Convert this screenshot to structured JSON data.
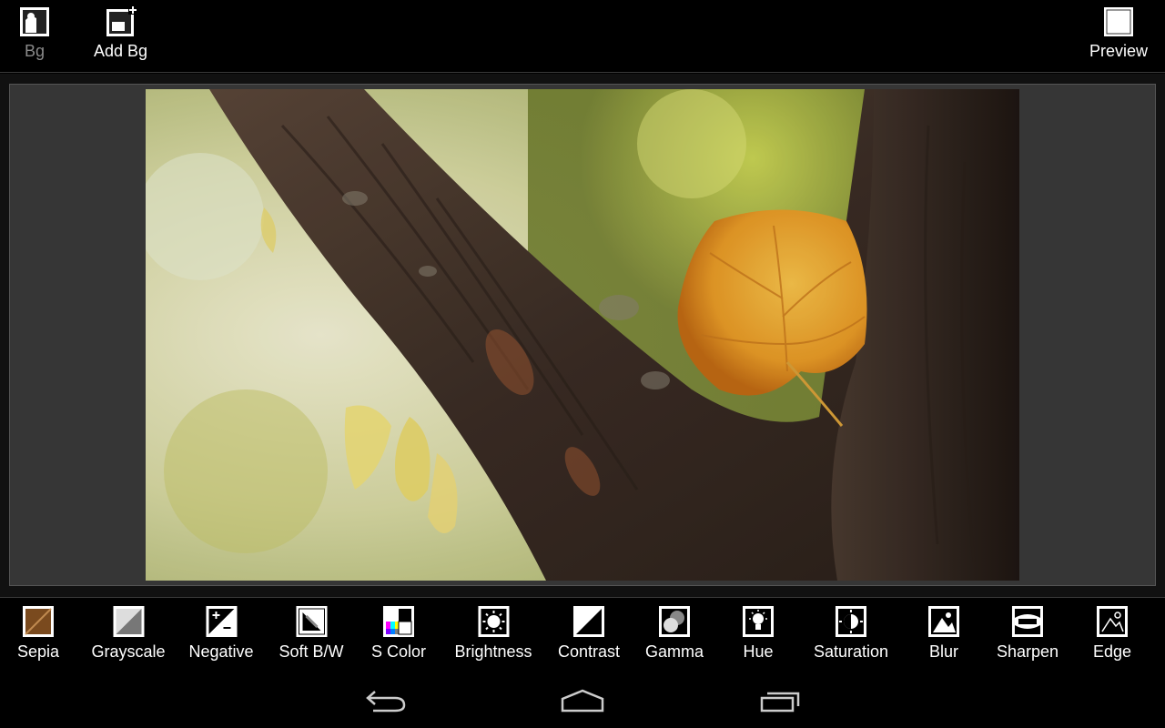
{
  "toolbar": {
    "bg_label": "Bg",
    "add_bg_label": "Add Bg",
    "preview_label": "Preview"
  },
  "effects": [
    {
      "label": "Sepia",
      "icon": "sepia-icon"
    },
    {
      "label": "Grayscale",
      "icon": "grayscale-icon"
    },
    {
      "label": "Negative",
      "icon": "negative-icon"
    },
    {
      "label": "Soft B/W",
      "icon": "soft-bw-icon"
    },
    {
      "label": "S Color",
      "icon": "s-color-icon"
    },
    {
      "label": "Brightness",
      "icon": "brightness-icon"
    },
    {
      "label": "Contrast",
      "icon": "contrast-icon"
    },
    {
      "label": "Gamma",
      "icon": "gamma-icon"
    },
    {
      "label": "Hue",
      "icon": "hue-icon"
    },
    {
      "label": "Saturation",
      "icon": "saturation-icon"
    },
    {
      "label": "Blur",
      "icon": "blur-icon"
    },
    {
      "label": "Sharpen",
      "icon": "sharpen-icon"
    },
    {
      "label": "Edge",
      "icon": "edge-icon"
    }
  ],
  "nav": {
    "back_icon": "back-icon",
    "home_icon": "home-icon",
    "recents_icon": "recent-apps-icon"
  },
  "colors": {
    "bar_bg": "#000000",
    "canvas_bg": "#363636",
    "disabled_text": "#8a8a8a",
    "sepia_swatch": "#7a4a1e"
  }
}
